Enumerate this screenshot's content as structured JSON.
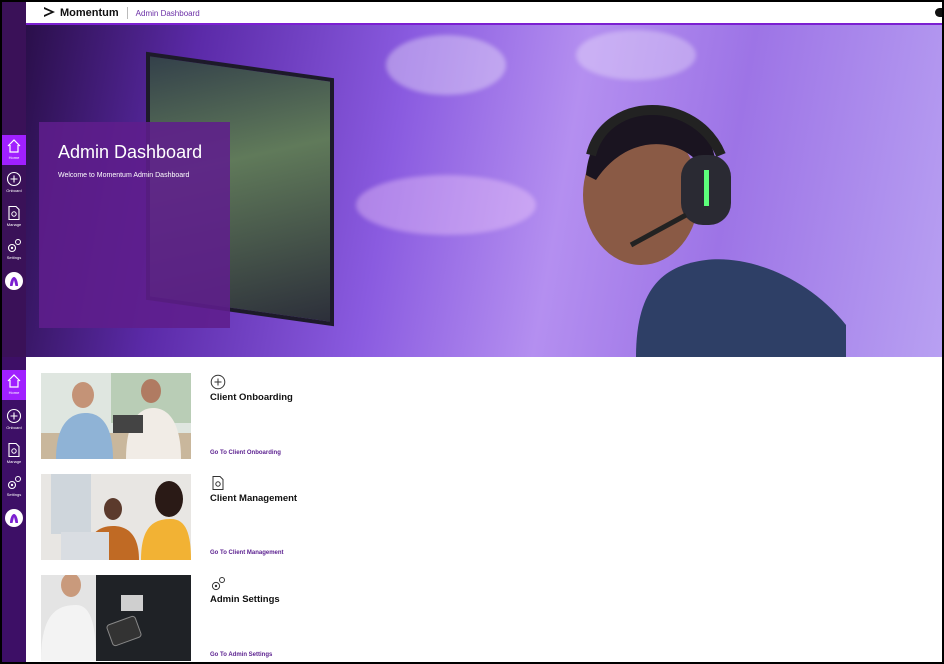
{
  "header": {
    "brand": "Momentum",
    "breadcrumb": "Admin Dashboard"
  },
  "sidebar": {
    "items": [
      {
        "label": "Home",
        "icon": "home-icon",
        "active": true
      },
      {
        "label": "Onboard",
        "icon": "plus-circle-icon"
      },
      {
        "label": "Manage",
        "icon": "document-gear-icon"
      },
      {
        "label": "Settings",
        "icon": "gears-icon"
      }
    ],
    "avatar_icon": "user-avatar-icon"
  },
  "hero": {
    "title": "Admin Dashboard",
    "subtitle": "Welcome to Momentum Admin Dashboard"
  },
  "cards": [
    {
      "title": "Client Onboarding",
      "link": "Go To Client Onboarding",
      "icon": "plus-circle-icon"
    },
    {
      "title": "Client Management",
      "link": "Go To Client Management",
      "icon": "document-gear-icon"
    },
    {
      "title": "Admin Settings",
      "link": "Go To Admin Settings",
      "icon": "gears-icon"
    }
  ],
  "colors": {
    "accent": "#a020ff",
    "sidebar": "#3a1158",
    "link": "#5a1f8f",
    "hero_overlay": "#5e1e8c"
  }
}
